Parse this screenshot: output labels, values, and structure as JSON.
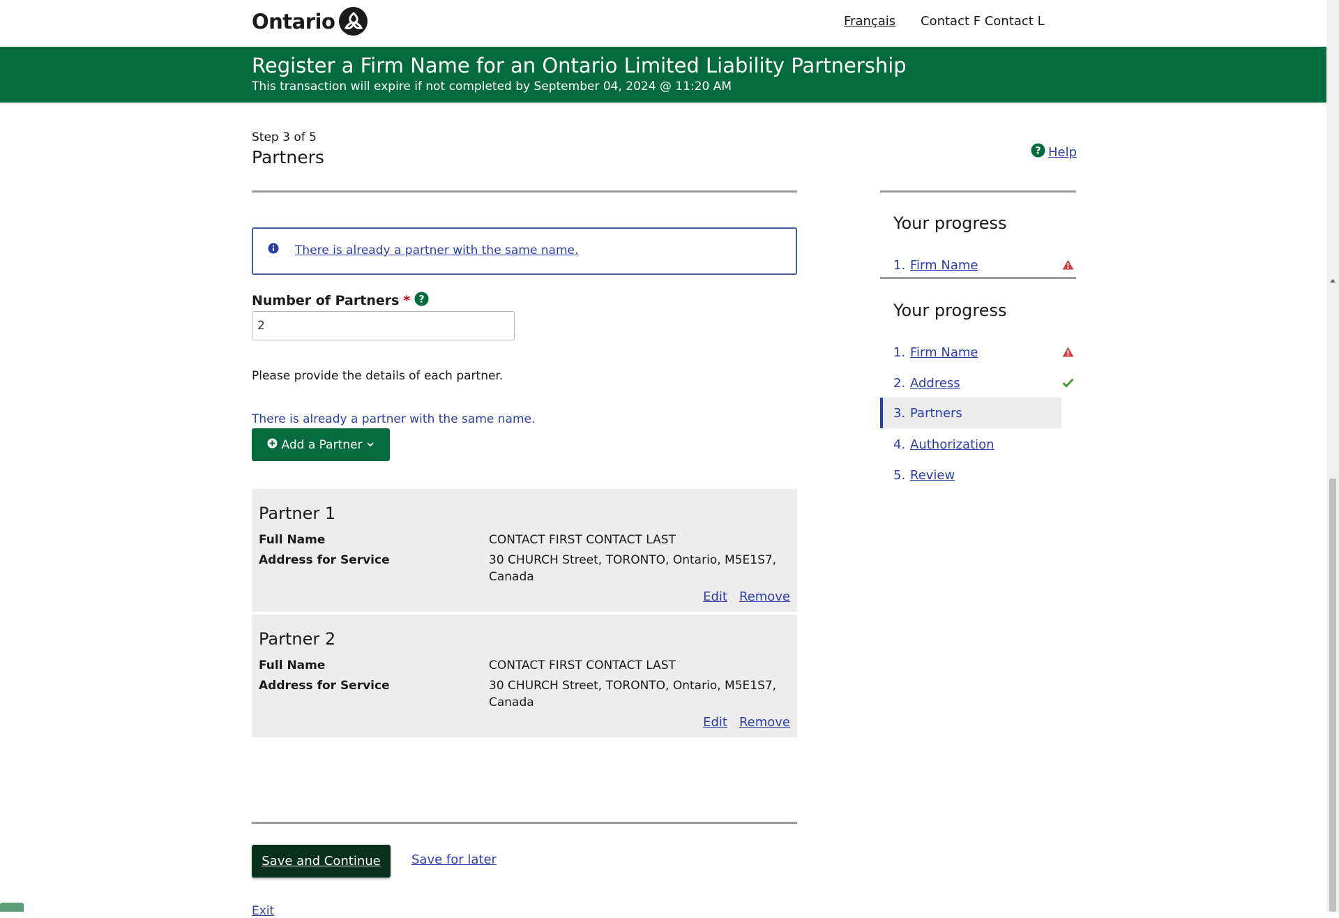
{
  "header": {
    "logo_text": "Ontario",
    "language_link": "Français",
    "user_name": "Contact F Contact L"
  },
  "banner": {
    "title": "Register a Firm Name for an Ontario Limited Liability Partnership",
    "subtitle": "This transaction will expire if not completed by September 04, 2024 @ 11:20 AM"
  },
  "step": {
    "label": "Step 3 of 5",
    "title": "Partners",
    "help": "Help"
  },
  "alert": {
    "message": "There is already a partner with the same name."
  },
  "form": {
    "number_label": "Number of Partners",
    "required_marker": "*",
    "number_value": "2",
    "instructions": "Please provide the details of each partner.",
    "error_text": "There is already a partner with the same name.",
    "add_button": "Add a Partner"
  },
  "partners": [
    {
      "title": "Partner 1",
      "name_label": "Full Name",
      "name_value": "CONTACT FIRST CONTACT LAST",
      "address_label": "Address for Service",
      "address_value": "30 CHURCH Street, TORONTO, Ontario, M5E1S7, Canada",
      "edit": "Edit",
      "remove": "Remove"
    },
    {
      "title": "Partner 2",
      "name_label": "Full Name",
      "name_value": "CONTACT FIRST CONTACT LAST",
      "address_label": "Address for Service",
      "address_value": "30 CHURCH Street, TORONTO, Ontario, M5E1S7, Canada",
      "edit": "Edit",
      "remove": "Remove"
    }
  ],
  "footer": {
    "save_continue": "Save and Continue",
    "save_later": "Save for later",
    "exit": "Exit"
  },
  "progress_mini": {
    "heading": "Your progress",
    "items": [
      {
        "num": "1.",
        "label": "Firm Name",
        "status": "warning"
      }
    ]
  },
  "progress": {
    "heading": "Your progress",
    "items": [
      {
        "num": "1.",
        "label": "Firm Name",
        "status": "warning"
      },
      {
        "num": "2.",
        "label": "Address",
        "status": "complete"
      },
      {
        "num": "3.",
        "label": "Partners",
        "status": "current"
      },
      {
        "num": "4.",
        "label": "Authorization",
        "status": "none"
      },
      {
        "num": "5.",
        "label": "Review",
        "status": "none"
      }
    ]
  },
  "colors": {
    "brand_green": "#046b3f",
    "dark_green": "#08301d",
    "link_blue": "#2b3fa8",
    "warning_red": "#d04040",
    "check_green": "#4a9a3a"
  }
}
